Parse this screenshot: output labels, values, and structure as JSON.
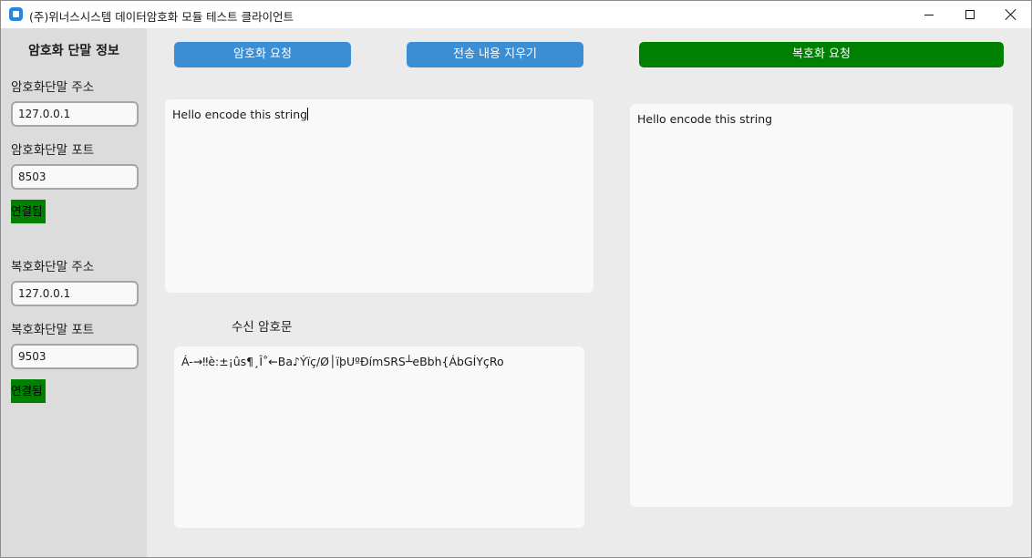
{
  "window": {
    "title": "(주)위너스시스템 데이터암호화 모듈 테스트 클라이언트"
  },
  "sidebar": {
    "title": "암호화 단말 정보",
    "encrypt": {
      "address_label": "암호화단말 주소",
      "address_value": "127.0.0.1",
      "port_label": "암호화단말 포트",
      "port_value": "8503",
      "status": "연결됨"
    },
    "decrypt": {
      "address_label": "복호화단말 주소",
      "address_value": "127.0.0.1",
      "port_label": "복호화단말 포트",
      "port_value": "9503",
      "status": "연결됨"
    }
  },
  "toolbar": {
    "encrypt_request_label": "암호화 요청",
    "clear_sent_label": "전송 내용 지우기",
    "decrypt_request_label": "복호화 요청"
  },
  "main": {
    "input_text": "Hello encode this string",
    "received_cipher_label": "수신 암호문",
    "cipher_text": "Á-→‼è:±¡ûs¶¸Î˚←Ba♪Ýïç/Ø│ïþUºÐímSRS┴eBbh{ÁbGÍYçRo",
    "decrypted_text": "Hello encode this string"
  },
  "colors": {
    "blue_button": "#3b8ed3",
    "green_button": "#008000",
    "status_connected": "#008000"
  },
  "icons": {
    "app": "app-icon",
    "minimize": "minimize-icon",
    "maximize": "maximize-icon",
    "close": "close-icon"
  }
}
